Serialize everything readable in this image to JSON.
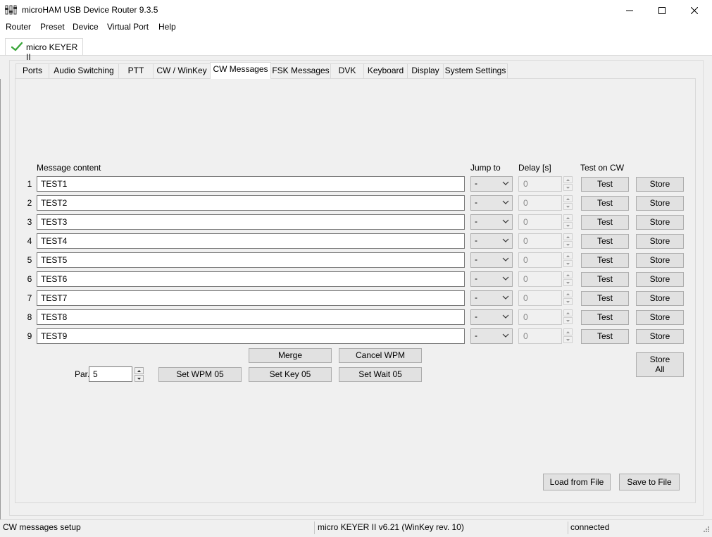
{
  "window": {
    "title": "microHAM USB Device Router 9.3.5",
    "controls": {
      "minimize": "—",
      "maximize": "☐",
      "close": "✕"
    }
  },
  "menu": [
    "Router",
    "Preset",
    "Device",
    "Virtual Port",
    "Help"
  ],
  "device_tab": {
    "label": "micro KEYER II",
    "status_icon": "checkmark-icon",
    "status_color": "#3aa63a"
  },
  "tabs": [
    "Ports",
    "Audio Switching",
    "PTT",
    "CW / WinKey",
    "CW Messages",
    "FSK Messages",
    "DVK",
    "Keyboard",
    "Display",
    "System Settings"
  ],
  "active_tab": "CW Messages",
  "table": {
    "headers": {
      "message": "Message content",
      "jump": "Jump to",
      "delay": "Delay [s]",
      "test": "Test on CW"
    },
    "rows": [
      {
        "num": "1",
        "message": "TEST1",
        "jump": "-",
        "delay": "0"
      },
      {
        "num": "2",
        "message": "TEST2",
        "jump": "-",
        "delay": "0"
      },
      {
        "num": "3",
        "message": "TEST3",
        "jump": "-",
        "delay": "0"
      },
      {
        "num": "4",
        "message": "TEST4",
        "jump": "-",
        "delay": "0"
      },
      {
        "num": "5",
        "message": "TEST5",
        "jump": "-",
        "delay": "0"
      },
      {
        "num": "6",
        "message": "TEST6",
        "jump": "-",
        "delay": "0"
      },
      {
        "num": "7",
        "message": "TEST7",
        "jump": "-",
        "delay": "0"
      },
      {
        "num": "8",
        "message": "TEST8",
        "jump": "-",
        "delay": "0"
      },
      {
        "num": "9",
        "message": "TEST9",
        "jump": "-",
        "delay": "0"
      }
    ],
    "test_label": "Test",
    "store_label": "Store"
  },
  "controls": {
    "merge": "Merge",
    "cancel_wpm": "Cancel WPM",
    "par_label": "Par.",
    "par_value": "5",
    "set_wpm": "Set WPM 05",
    "set_key": "Set Key 05",
    "set_wait": "Set Wait 05",
    "store_all_1": "Store",
    "store_all_2": "All",
    "load_file": "Load from File",
    "save_file": "Save to File"
  },
  "status": {
    "left": "CW messages setup",
    "middle": "micro KEYER II v6.21 (WinKey rev. 10)",
    "right": "connected"
  }
}
